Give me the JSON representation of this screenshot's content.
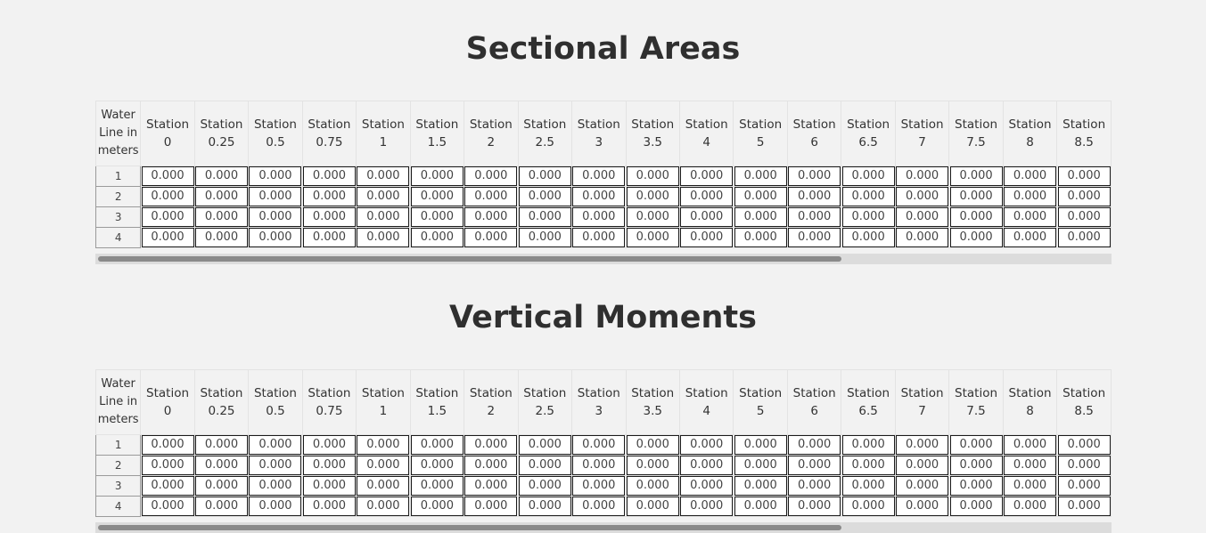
{
  "sections": [
    {
      "title": "Sectional Areas",
      "headers": [
        "Water Line in meters",
        "Station 0",
        "Station 0.25",
        "Station 0.5",
        "Station 0.75",
        "Station 1",
        "Station 1.5",
        "Station 2",
        "Station 2.5",
        "Station 3",
        "Station 3.5",
        "Station 4",
        "Station 5",
        "Station 6",
        "Station 6.5",
        "Station 7",
        "Station 7.5",
        "Station 8",
        "Station 8.5"
      ],
      "rows": [
        {
          "label": "1",
          "values": [
            "0.000",
            "0.000",
            "0.000",
            "0.000",
            "0.000",
            "0.000",
            "0.000",
            "0.000",
            "0.000",
            "0.000",
            "0.000",
            "0.000",
            "0.000",
            "0.000",
            "0.000",
            "0.000",
            "0.000",
            "0.000"
          ]
        },
        {
          "label": "2",
          "values": [
            "0.000",
            "0.000",
            "0.000",
            "0.000",
            "0.000",
            "0.000",
            "0.000",
            "0.000",
            "0.000",
            "0.000",
            "0.000",
            "0.000",
            "0.000",
            "0.000",
            "0.000",
            "0.000",
            "0.000",
            "0.000"
          ]
        },
        {
          "label": "3",
          "values": [
            "0.000",
            "0.000",
            "0.000",
            "0.000",
            "0.000",
            "0.000",
            "0.000",
            "0.000",
            "0.000",
            "0.000",
            "0.000",
            "0.000",
            "0.000",
            "0.000",
            "0.000",
            "0.000",
            "0.000",
            "0.000"
          ]
        },
        {
          "label": "4",
          "values": [
            "0.000",
            "0.000",
            "0.000",
            "0.000",
            "0.000",
            "0.000",
            "0.000",
            "0.000",
            "0.000",
            "0.000",
            "0.000",
            "0.000",
            "0.000",
            "0.000",
            "0.000",
            "0.000",
            "0.000",
            "0.000"
          ]
        }
      ]
    },
    {
      "title": "Vertical Moments",
      "headers": [
        "Water Line in meters",
        "Station 0",
        "Station 0.25",
        "Station 0.5",
        "Station 0.75",
        "Station 1",
        "Station 1.5",
        "Station 2",
        "Station 2.5",
        "Station 3",
        "Station 3.5",
        "Station 4",
        "Station 5",
        "Station 6",
        "Station 6.5",
        "Station 7",
        "Station 7.5",
        "Station 8",
        "Station 8.5"
      ],
      "rows": [
        {
          "label": "1",
          "values": [
            "0.000",
            "0.000",
            "0.000",
            "0.000",
            "0.000",
            "0.000",
            "0.000",
            "0.000",
            "0.000",
            "0.000",
            "0.000",
            "0.000",
            "0.000",
            "0.000",
            "0.000",
            "0.000",
            "0.000",
            "0.000"
          ]
        },
        {
          "label": "2",
          "values": [
            "0.000",
            "0.000",
            "0.000",
            "0.000",
            "0.000",
            "0.000",
            "0.000",
            "0.000",
            "0.000",
            "0.000",
            "0.000",
            "0.000",
            "0.000",
            "0.000",
            "0.000",
            "0.000",
            "0.000",
            "0.000"
          ]
        },
        {
          "label": "3",
          "values": [
            "0.000",
            "0.000",
            "0.000",
            "0.000",
            "0.000",
            "0.000",
            "0.000",
            "0.000",
            "0.000",
            "0.000",
            "0.000",
            "0.000",
            "0.000",
            "0.000",
            "0.000",
            "0.000",
            "0.000",
            "0.000"
          ]
        },
        {
          "label": "4",
          "values": [
            "0.000",
            "0.000",
            "0.000",
            "0.000",
            "0.000",
            "0.000",
            "0.000",
            "0.000",
            "0.000",
            "0.000",
            "0.000",
            "0.000",
            "0.000",
            "0.000",
            "0.000",
            "0.000",
            "0.000",
            "0.000"
          ]
        }
      ]
    }
  ]
}
